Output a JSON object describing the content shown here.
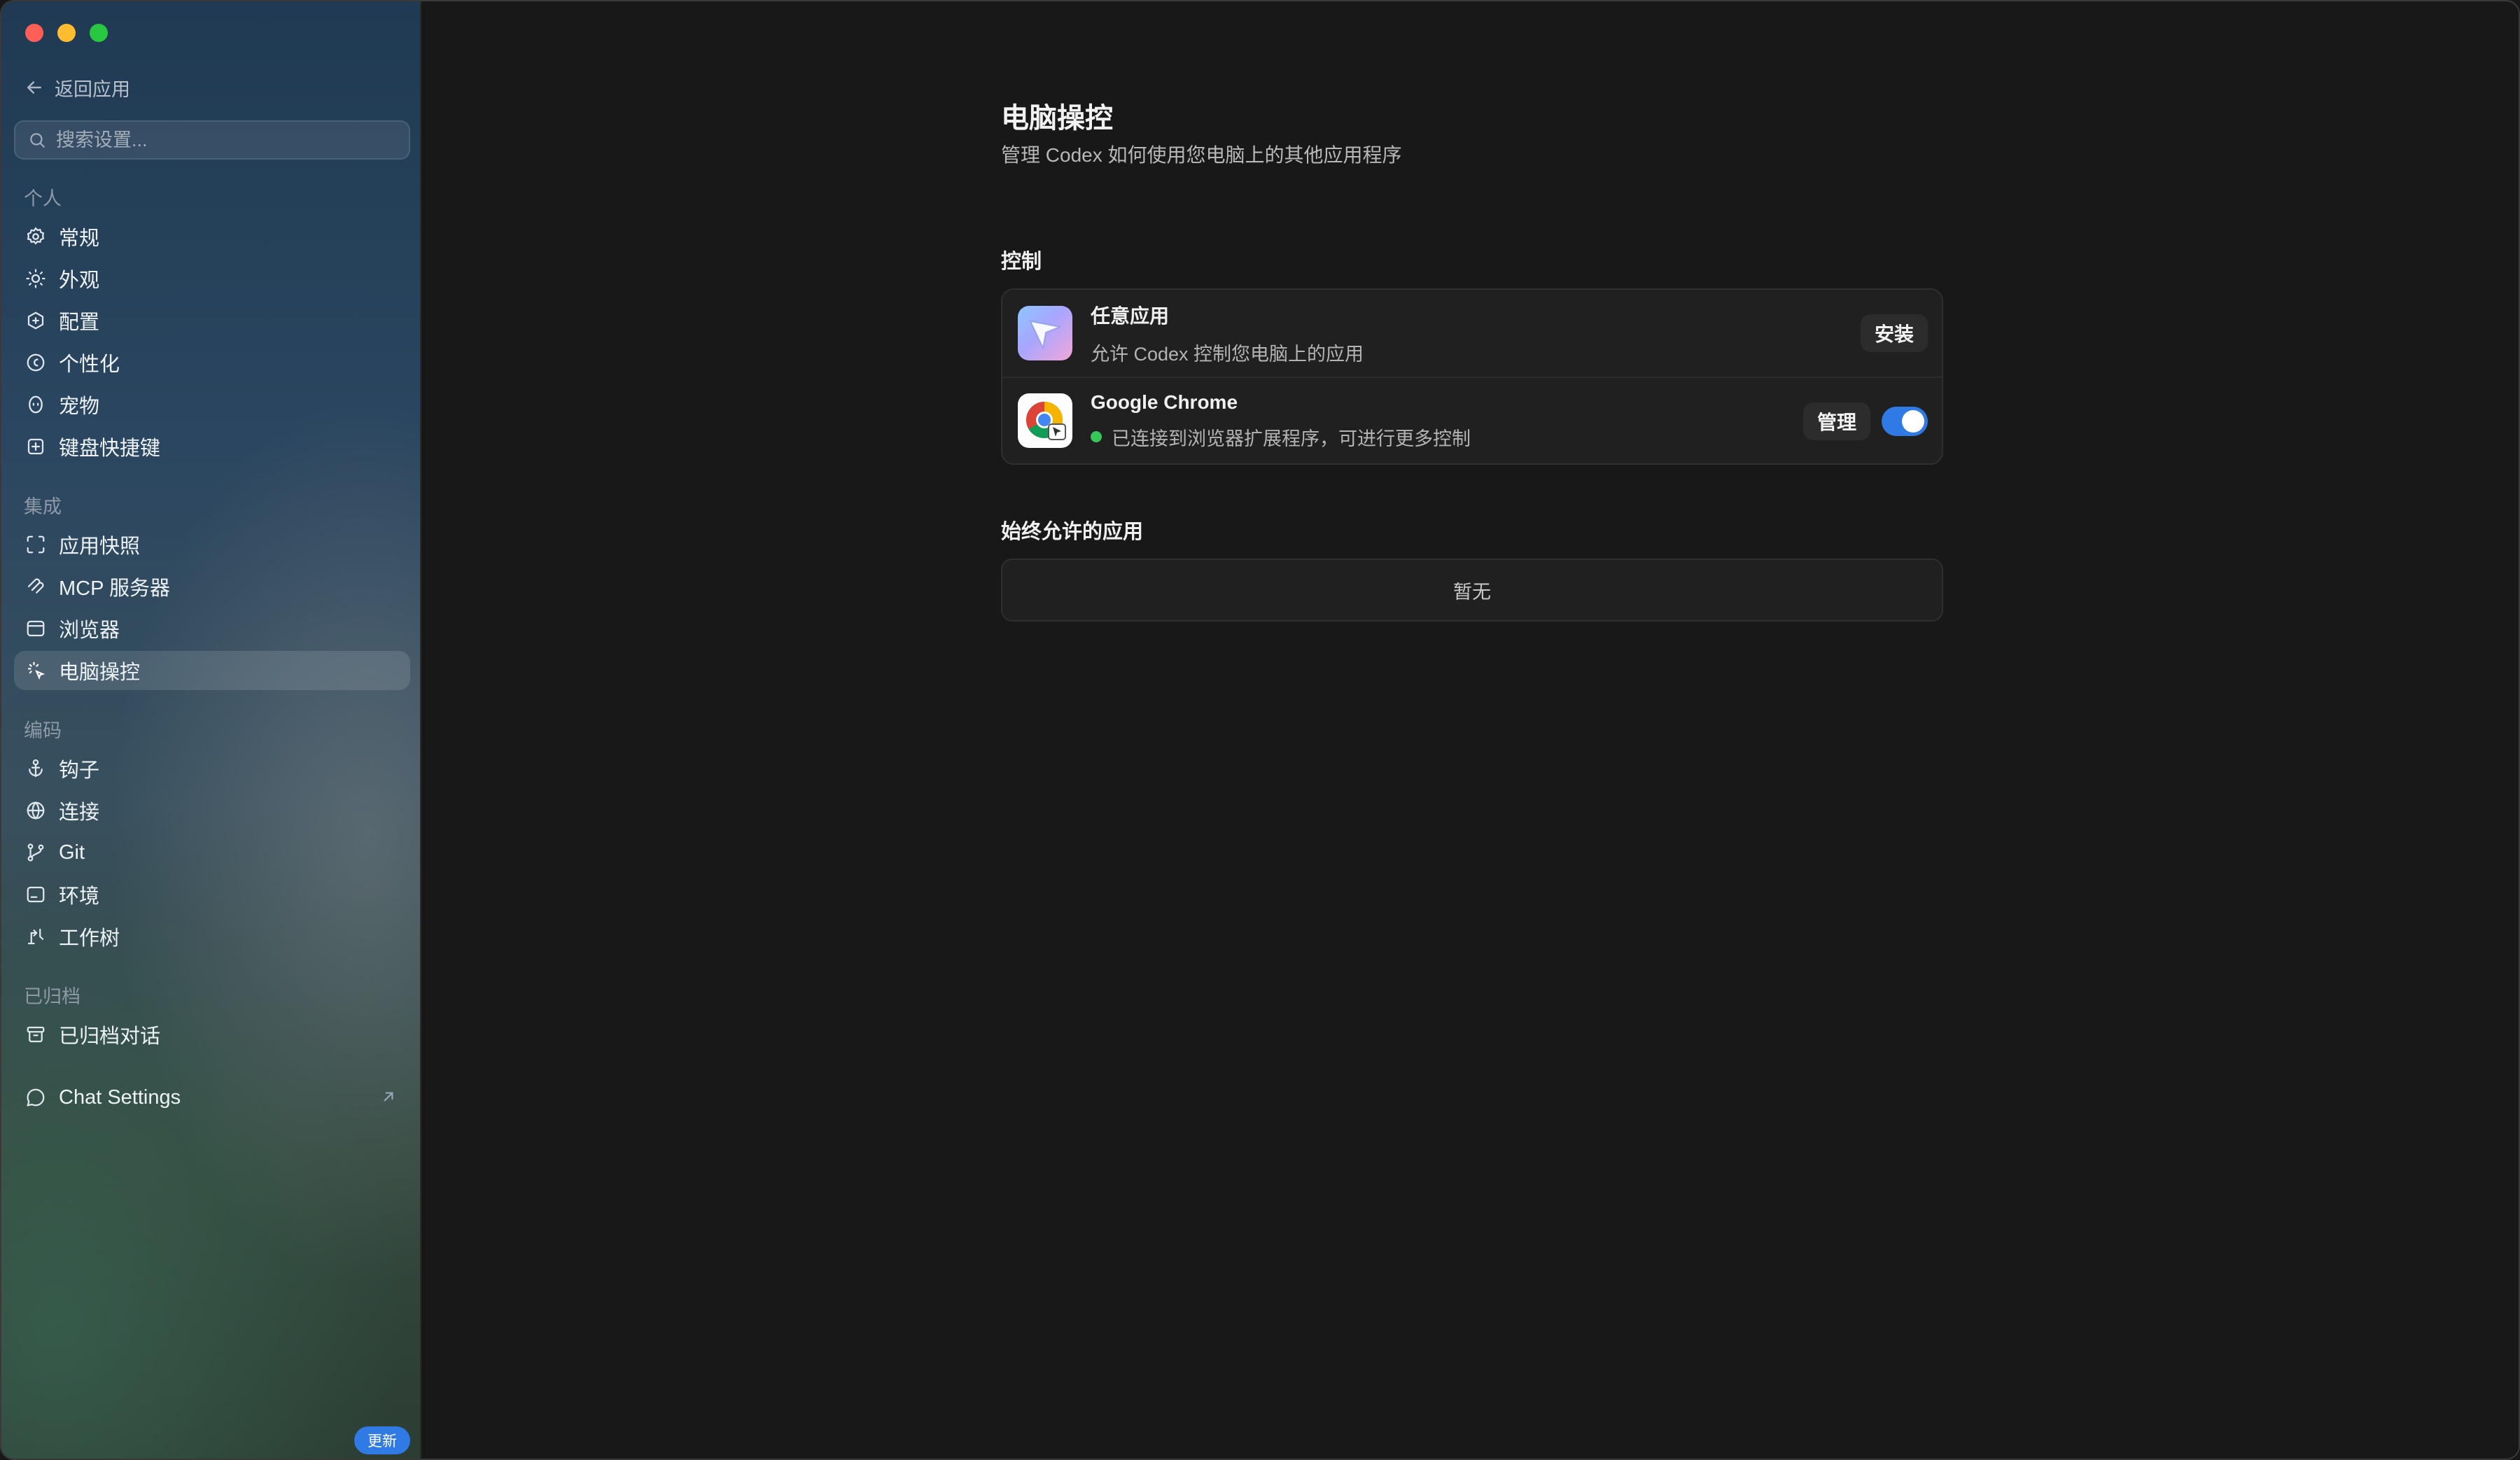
{
  "sidebar": {
    "back_label": "返回应用",
    "search_placeholder": "搜索设置...",
    "sections": {
      "personal": "个人",
      "integrations": "集成",
      "coding": "编码",
      "archived": "已归档"
    },
    "items": {
      "general": "常规",
      "appearance": "外观",
      "config": "配置",
      "personalization": "个性化",
      "pets": "宠物",
      "shortcuts": "键盘快捷键",
      "app_snapshot": "应用快照",
      "mcp": "MCP 服务器",
      "browser": "浏览器",
      "computer_control": "电脑操控",
      "hooks": "钩子",
      "connections": "连接",
      "git": "Git",
      "environment": "环境",
      "worktree": "工作树",
      "archived_chats": "已归档对话",
      "chat_settings": "Chat Settings"
    },
    "active_item": "computer_control",
    "update_badge": "更新"
  },
  "main": {
    "title": "电脑操控",
    "subtitle": "管理 Codex 如何使用您电脑上的其他应用程序",
    "control_section": {
      "title": "控制",
      "rows": [
        {
          "icon": "codex-cursor-app-icon",
          "title": "任意应用",
          "description": "允许 Codex 控制您电脑上的应用",
          "action_label": "安装"
        },
        {
          "icon": "google-chrome-icon",
          "title": "Google Chrome",
          "description": "已连接到浏览器扩展程序，可进行更多控制",
          "status": "connected",
          "action_label": "管理",
          "toggle_on": true
        }
      ]
    },
    "allowed_section": {
      "title": "始终允许的应用",
      "empty_text": "暂无"
    }
  },
  "colors": {
    "accent": "#2f7ae5",
    "status_connected": "#35c759",
    "background": "#181818"
  }
}
